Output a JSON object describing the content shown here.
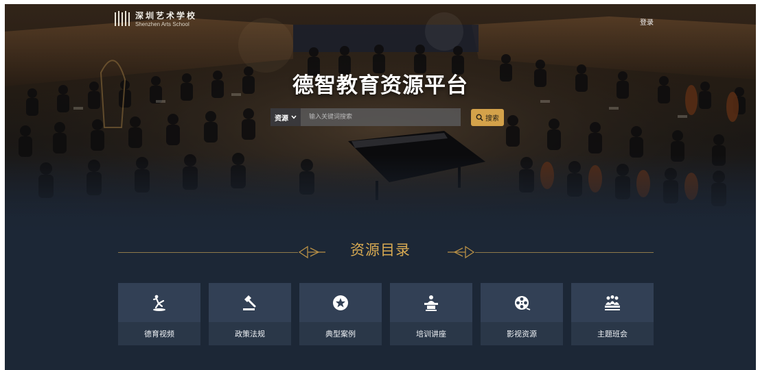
{
  "brand": {
    "name_cn": "深圳艺术学校",
    "name_en": "Shenzhen Arts School"
  },
  "header": {
    "login_label": "登录"
  },
  "hero": {
    "title": "德智教育资源平台"
  },
  "search": {
    "type_label": "资源",
    "placeholder": "输入关键词搜索",
    "button_label": "搜索"
  },
  "section": {
    "title": "资源目录"
  },
  "categories": [
    {
      "label": "德育视频",
      "icon": "dance-figure-icon"
    },
    {
      "label": "政策法规",
      "icon": "gavel-icon"
    },
    {
      "label": "典型案例",
      "icon": "star-badge-icon"
    },
    {
      "label": "培训讲座",
      "icon": "lecturer-podium-icon"
    },
    {
      "label": "影视资源",
      "icon": "film-reel-icon"
    },
    {
      "label": "主题班会",
      "icon": "group-meeting-icon"
    }
  ],
  "colors": {
    "accent_gold": "#d4a24a",
    "page_bg": "#1c2736",
    "card_top": "#324055",
    "card_bottom": "#2a3748"
  }
}
